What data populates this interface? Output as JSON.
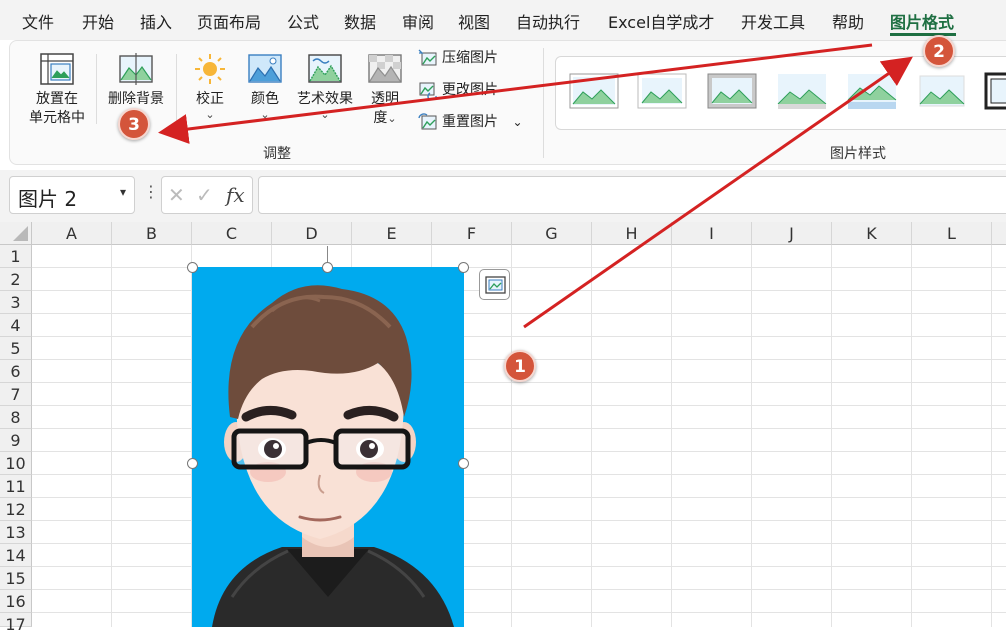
{
  "tabs": [
    "文件",
    "开始",
    "插入",
    "页面布局",
    "公式",
    "数据",
    "审阅",
    "视图",
    "自动执行",
    "Excel自学成才",
    "开发工具",
    "帮助",
    "图片格式"
  ],
  "ribbon": {
    "place_in_cell": [
      "放置在",
      "单元格中"
    ],
    "remove_background": "删除背景",
    "corrections": "校正",
    "color": "颜色",
    "artistic_effects": "艺术效果",
    "transparency": [
      "透明",
      "度"
    ],
    "compress": "压缩图片",
    "change": "更改图片",
    "reset": "重置图片",
    "adjust_group": "调整",
    "styles_group": "图片样式"
  },
  "formula_bar": {
    "name_box": "图片 2",
    "fx": "fx",
    "formula": ""
  },
  "grid": {
    "columns": [
      "A",
      "B",
      "C",
      "D",
      "E",
      "F",
      "G",
      "H",
      "I",
      "J",
      "K",
      "L"
    ],
    "rows": [
      "1",
      "2",
      "3",
      "4",
      "5",
      "6",
      "7",
      "8",
      "9",
      "10",
      "11",
      "12",
      "13",
      "14",
      "15",
      "16",
      "17"
    ]
  },
  "annotations": [
    "1",
    "2",
    "3"
  ],
  "colors": {
    "active_tab": "#1e6f42",
    "picture_bg": "#00aaee",
    "badge": "#d4553b",
    "arrow": "#d42222"
  }
}
